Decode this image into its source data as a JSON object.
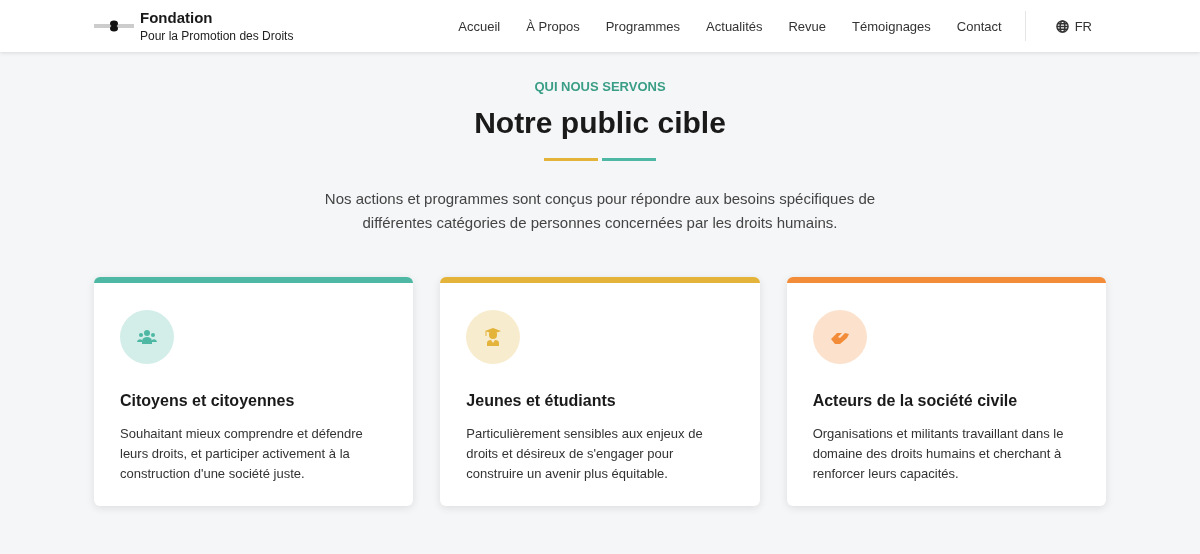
{
  "header": {
    "brand": "Fondation",
    "tagline": "Pour la Promotion des Droits",
    "nav": [
      "Accueil",
      "À Propos",
      "Programmes",
      "Actualités",
      "Revue",
      "Témoignages",
      "Contact"
    ],
    "language": "FR"
  },
  "section": {
    "eyebrow": "QUI NOUS SERVONS",
    "title": "Notre public cible",
    "intro": "Nos actions et programmes sont conçus pour répondre aux besoins spécifiques de différentes catégories de personnes concernées par les droits humains."
  },
  "cards": [
    {
      "kind": "people",
      "color": "#4fb8a4",
      "title": "Citoyens et citoyennes",
      "text": "Souhaitant mieux comprendre et défendre leurs droits, et participer activement à la construction d'une société juste."
    },
    {
      "kind": "graduate",
      "color": "#e4b33a",
      "title": "Jeunes et étudiants",
      "text": "Particulièrement sensibles aux enjeux de droits et désireux de s'engager pour construire un avenir plus équitable."
    },
    {
      "kind": "handshake",
      "color": "#f28c38",
      "title": "Acteurs de la société civile",
      "text": "Organisations et militants travaillant dans le domaine des droits humains et cherchant à renforcer leurs capacités."
    }
  ]
}
